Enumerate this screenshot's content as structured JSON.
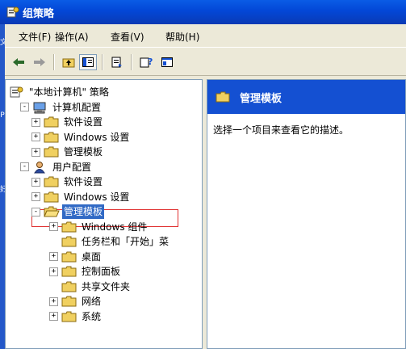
{
  "window": {
    "title": "组策略"
  },
  "side_strip": {
    "marks": [
      "文",
      "P",
      "好"
    ]
  },
  "menu": [
    "文件(F)",
    "操作(A)",
    "查看(V)",
    "帮助(H)"
  ],
  "toolbar": {
    "buttons": [
      "back-arrow-icon",
      "forward-arrow-icon",
      "up-folder-icon",
      "show-tree-icon",
      "export-list-icon",
      "help-icon",
      "console-window-icon"
    ]
  },
  "tree": [
    {
      "label": "\"本地计算机\" 策略",
      "level": 0,
      "icon": "policy-icon",
      "expander": ""
    },
    {
      "label": "计算机配置",
      "level": 1,
      "icon": "computer-icon",
      "expander": "-"
    },
    {
      "label": "软件设置",
      "level": 2,
      "icon": "folder-icon",
      "expander": "+"
    },
    {
      "label": "Windows 设置",
      "level": 2,
      "icon": "folder-icon",
      "expander": "+"
    },
    {
      "label": "管理模板",
      "level": 2,
      "icon": "folder-icon",
      "expander": "+"
    },
    {
      "label": "用户配置",
      "level": 1,
      "icon": "user-icon",
      "expander": "-"
    },
    {
      "label": "软件设置",
      "level": 2,
      "icon": "folder-icon",
      "expander": "+"
    },
    {
      "label": "Windows 设置",
      "level": 2,
      "icon": "folder-icon",
      "expander": "+"
    },
    {
      "label": "管理模板",
      "level": 2,
      "icon": "open-folder-icon",
      "expander": "-",
      "selected": true
    },
    {
      "label": "Windows 组件",
      "level": 3,
      "icon": "folder-icon",
      "expander": "+"
    },
    {
      "label": "任务栏和「开始」菜",
      "level": 3,
      "icon": "folder-icon",
      "expander": ""
    },
    {
      "label": "桌面",
      "level": 3,
      "icon": "folder-icon",
      "expander": "+"
    },
    {
      "label": "控制面板",
      "level": 3,
      "icon": "folder-icon",
      "expander": "+"
    },
    {
      "label": "共享文件夹",
      "level": 3,
      "icon": "folder-icon",
      "expander": ""
    },
    {
      "label": "网络",
      "level": 3,
      "icon": "folder-icon",
      "expander": "+"
    },
    {
      "label": "系统",
      "level": 3,
      "icon": "folder-icon",
      "expander": "+"
    }
  ],
  "details": {
    "title": "管理模板",
    "description": "选择一个项目来查看它的描述。"
  },
  "colors": {
    "title_bar": "#0a5ce6",
    "selection": "#316ac5",
    "header": "#1450d2",
    "highlight_box": "#e03030"
  }
}
